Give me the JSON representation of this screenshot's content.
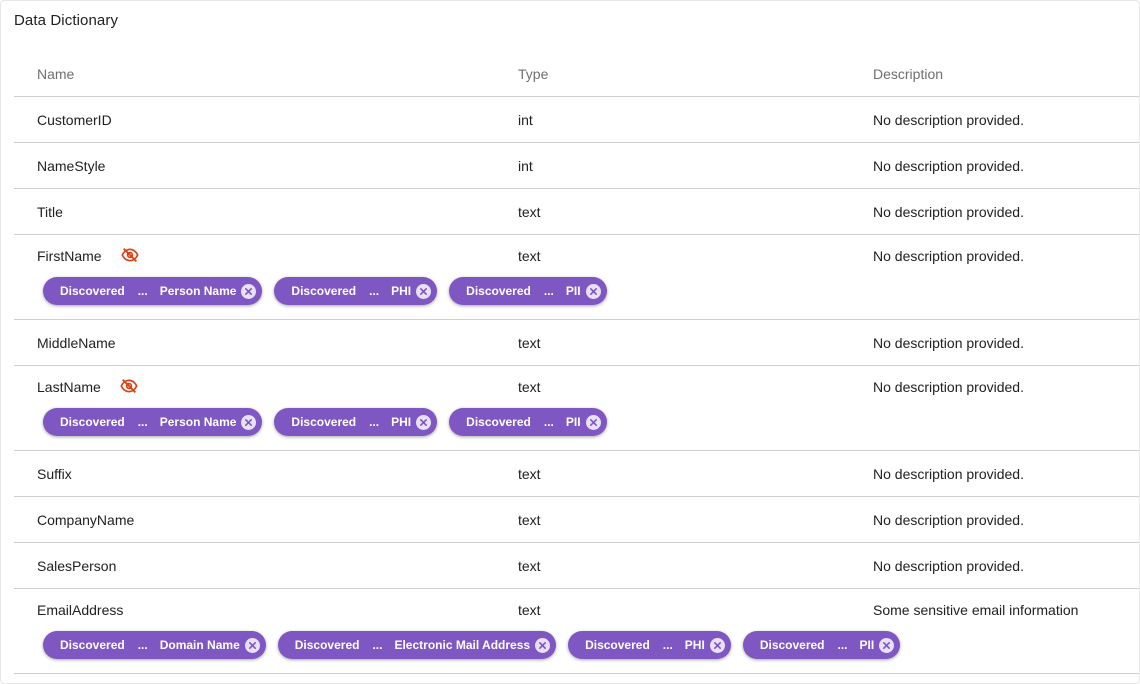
{
  "title": "Data Dictionary",
  "columns": {
    "name": "Name",
    "type": "Type",
    "description": "Description"
  },
  "rows": [
    {
      "name": "CustomerID",
      "type": "int",
      "description": "No description provided.",
      "masked": false,
      "tags": []
    },
    {
      "name": "NameStyle",
      "type": "int",
      "description": "No description provided.",
      "masked": false,
      "tags": []
    },
    {
      "name": "Title",
      "type": "text",
      "description": "No description provided.",
      "masked": false,
      "tags": []
    },
    {
      "name": "FirstName",
      "type": "text",
      "description": "No description provided.",
      "masked": true,
      "tags": [
        {
          "status": "Discovered",
          "sep": "...",
          "label": "Person Name"
        },
        {
          "status": "Discovered",
          "sep": "...",
          "label": "PHI"
        },
        {
          "status": "Discovered",
          "sep": "...",
          "label": "PII"
        }
      ]
    },
    {
      "name": "MiddleName",
      "type": "text",
      "description": "No description provided.",
      "masked": false,
      "tags": []
    },
    {
      "name": "LastName",
      "type": "text",
      "description": "No description provided.",
      "masked": true,
      "tags": [
        {
          "status": "Discovered",
          "sep": "...",
          "label": "Person Name"
        },
        {
          "status": "Discovered",
          "sep": "...",
          "label": "PHI"
        },
        {
          "status": "Discovered",
          "sep": "...",
          "label": "PII"
        }
      ]
    },
    {
      "name": "Suffix",
      "type": "text",
      "description": "No description provided.",
      "masked": false,
      "tags": []
    },
    {
      "name": "CompanyName",
      "type": "text",
      "description": "No description provided.",
      "masked": false,
      "tags": []
    },
    {
      "name": "SalesPerson",
      "type": "text",
      "description": "No description provided.",
      "masked": false,
      "tags": []
    },
    {
      "name": "EmailAddress",
      "type": "text",
      "description": "Some sensitive email information",
      "masked": false,
      "tags": [
        {
          "status": "Discovered",
          "sep": "...",
          "label": "Domain Name"
        },
        {
          "status": "Discovered",
          "sep": "...",
          "label": "Electronic Mail Address"
        },
        {
          "status": "Discovered",
          "sep": "...",
          "label": "PHI"
        },
        {
          "status": "Discovered",
          "sep": "...",
          "label": "PII"
        }
      ]
    }
  ],
  "icons": {
    "masked": "eye-off-icon",
    "remove_tag": "close-circle-icon"
  },
  "colors": {
    "tag_bg": "#7e57c2",
    "masked_icon": "#d84315",
    "divider": "#cfcfcf"
  }
}
